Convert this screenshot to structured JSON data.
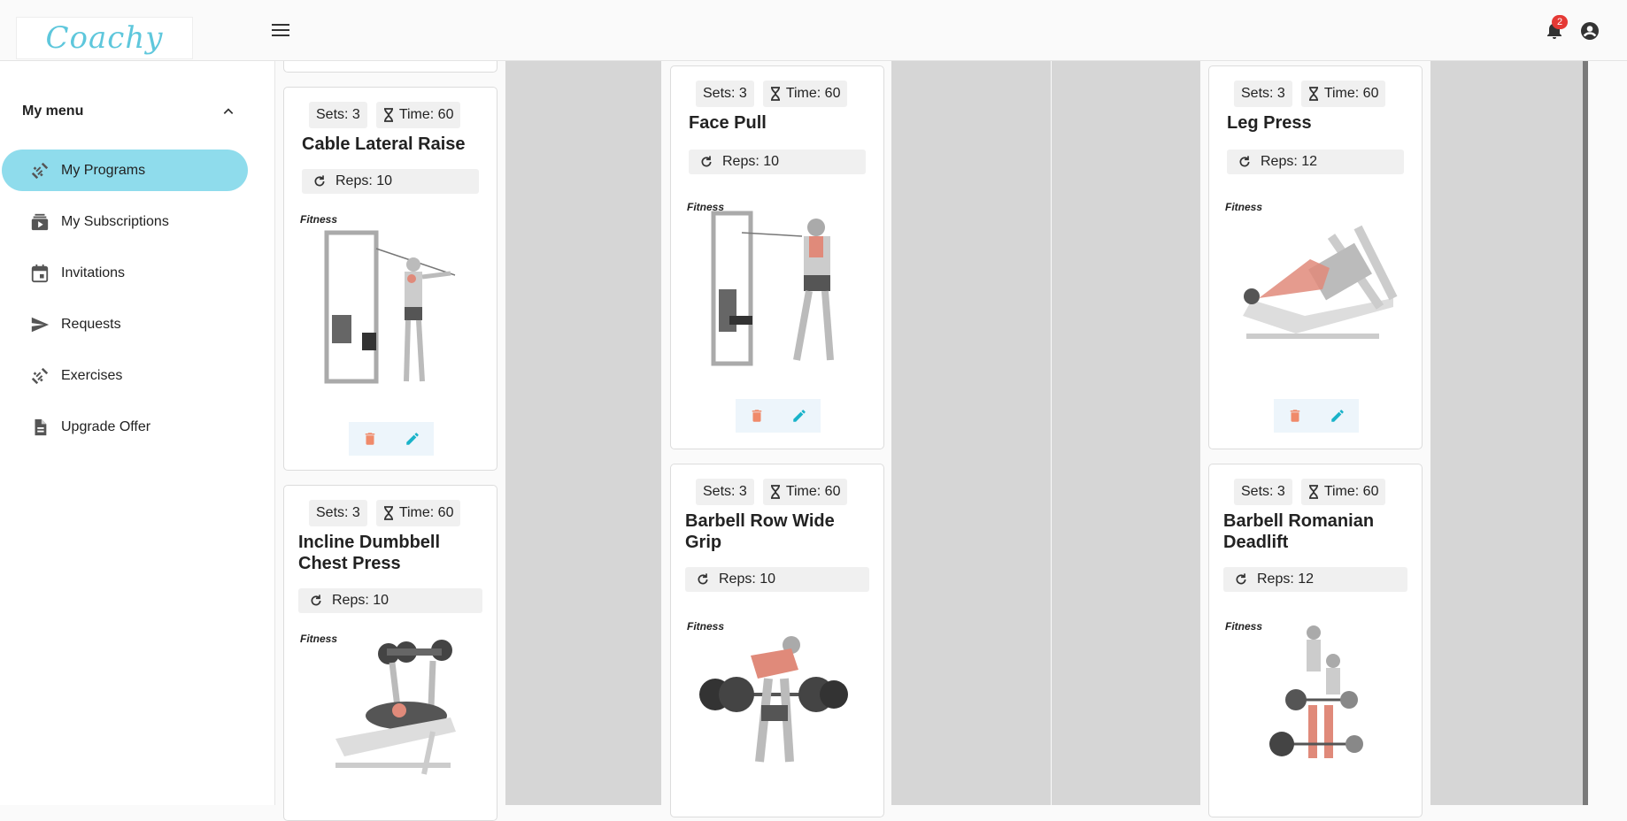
{
  "app": {
    "logo_text": "Coachy",
    "notification_count": "2"
  },
  "sidebar": {
    "menu_title": "My menu",
    "items": [
      {
        "label": "My Programs",
        "icon": "dumbbell-icon",
        "active": true
      },
      {
        "label": "My Subscriptions",
        "icon": "subscriptions-icon"
      },
      {
        "label": "Invitations",
        "icon": "calendar-icon"
      },
      {
        "label": "Requests",
        "icon": "send-icon"
      },
      {
        "label": "Exercises",
        "icon": "dumbbell-icon"
      },
      {
        "label": "Upgrade Offer",
        "icon": "document-icon"
      }
    ]
  },
  "cards": {
    "c1": {
      "sets": "Sets: 3",
      "time": "Time: 60",
      "title": "Cable Lateral Raise",
      "reps": "Reps: 10",
      "brand": "Fitness"
    },
    "c2": {
      "sets": "Sets: 3",
      "time": "Time: 60",
      "title": "Incline Dumbbell Chest Press",
      "reps": "Reps: 10",
      "brand": "Fitness"
    },
    "c3": {
      "sets": "Sets: 3",
      "time": "Time: 60",
      "title": "Face Pull",
      "reps": "Reps: 10",
      "brand": "Fitness"
    },
    "c4": {
      "sets": "Sets: 3",
      "time": "Time: 60",
      "title": "Barbell Row Wide Grip",
      "reps": "Reps: 10",
      "brand": "Fitness"
    },
    "c5": {
      "sets": "Sets: 3",
      "time": "Time: 60",
      "title": "Leg Press",
      "reps": "Reps: 12",
      "brand": "Fitness"
    },
    "c6": {
      "sets": "Sets: 3",
      "time": "Time: 60",
      "title": "Barbell Romanian Deadlift",
      "reps": "Reps: 12",
      "brand": "Fitness"
    }
  },
  "colors": {
    "accent": "#8fdcec",
    "delete": "#f08a6a",
    "edit": "#1ab3c9",
    "column_gray": "#d6d6d6"
  }
}
